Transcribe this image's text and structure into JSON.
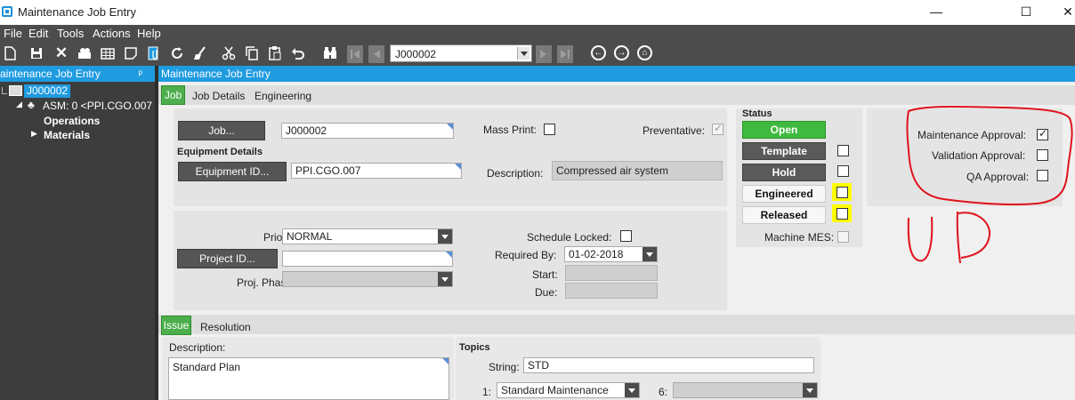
{
  "window": {
    "title": "Maintenance Job Entry",
    "minimize": "—",
    "maximize": "☐",
    "close": "✕"
  },
  "menu": [
    "File",
    "Edit",
    "Tools",
    "Actions",
    "Help"
  ],
  "toolbar": {
    "job_value": "J000002",
    "icons": [
      "new-icon",
      "save-icon",
      "delete-icon",
      "find-icon",
      "grid-icon",
      "note-icon",
      "attach-icon",
      "refresh-icon",
      "clear-icon",
      "cut-icon",
      "copy-icon",
      "paste-icon",
      "undo-icon",
      "binoculars-icon",
      "first-icon",
      "previous-icon",
      "next-icon",
      "last-icon",
      "back-icon",
      "forward-icon",
      "home-icon"
    ]
  },
  "tree": {
    "header": "aintenance Job Entry",
    "pin": "ᵖ",
    "root": "J000002",
    "asm": "ASM: 0 <PPI.CGO.007",
    "operations": "Operations",
    "materials": "Materials"
  },
  "main": {
    "header": "Maintenance Job Entry",
    "tabs": [
      "Job",
      "Job Details",
      "Engineering"
    ],
    "job": {
      "job_button": "Job...",
      "job_value": "J000002",
      "mass_print_label": "Mass Print:",
      "preventative_label": "Preventative:"
    },
    "equipment": {
      "section": "Equipment Details",
      "button": "Equipment ID...",
      "id_value": "PPI.CGO.007",
      "description_label": "Description:",
      "description_value": "Compressed air system"
    },
    "planning": {
      "priority_label": "Priority:",
      "priority_value": "NORMAL",
      "project_button": "Project ID...",
      "project_value": "",
      "phase_label": "Proj. Phase:",
      "schedule_locked_label": "Schedule Locked:",
      "required_by_label": "Required By:",
      "required_by_value": "01-02-2018",
      "start_label": "Start:",
      "due_label": "Due:"
    },
    "status": {
      "title": "Status",
      "open": "Open",
      "template": "Template",
      "hold": "Hold",
      "engineered": "Engineered",
      "released": "Released",
      "machine_mes": "Machine MES:"
    },
    "approvals": {
      "maintenance": "Maintenance Approval:",
      "validation": "Validation Approval:",
      "qa": "QA Approval:",
      "maintenance_checked": true,
      "validation_checked": false,
      "qa_checked": false
    },
    "lower_tabs": [
      "Issue",
      "Resolution"
    ],
    "issue": {
      "description_label": "Description:",
      "description_value": "Standard Plan",
      "topics_title": "Topics",
      "string_label": "String:",
      "string_value": "STD",
      "topic1_label": "1:",
      "topic1_value": "Standard Maintenance",
      "topic6_label": "6:"
    }
  },
  "annotation_color": "#e0121b",
  "highlight_color": "#ffff00"
}
